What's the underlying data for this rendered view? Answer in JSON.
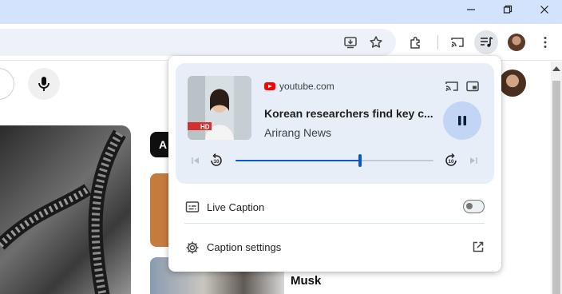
{
  "window": {
    "controls": {
      "minimize_icon": "minimize-icon",
      "restore_icon": "restore-icon",
      "close_icon": "close-icon"
    }
  },
  "toolbar": {
    "icons": [
      "install-app-icon",
      "bookmark-star-icon",
      "extensions-icon",
      "cast-icon",
      "media-controls-icon",
      "profile-avatar",
      "more-menu-icon"
    ]
  },
  "page": {
    "chip_label": "A",
    "video_label": "Musk"
  },
  "media": {
    "source": "youtube.com",
    "title": "Korean researchers find key c...",
    "artist": "Arirang News",
    "artwork_badge": "HD",
    "progress": 0.63,
    "accent": "#0b57d0",
    "card_bg": "#e8eef8",
    "play_bg": "#c2d5f5"
  },
  "live_caption": {
    "label": "Live Caption",
    "enabled": false
  },
  "caption_settings": {
    "label": "Caption settings"
  }
}
